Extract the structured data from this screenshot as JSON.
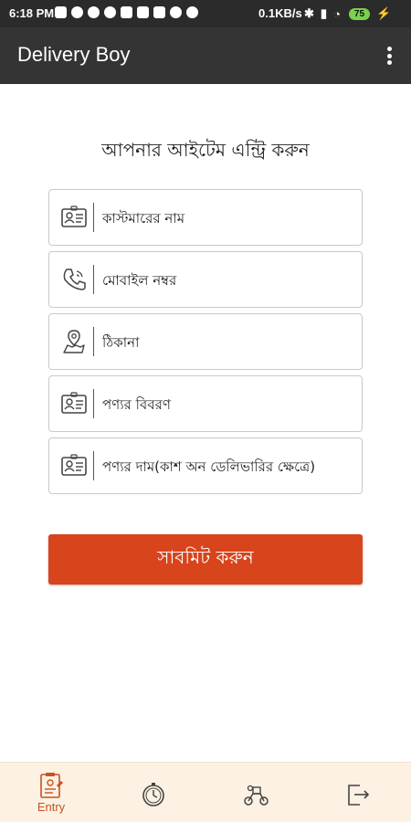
{
  "status_bar": {
    "time": "6:18 PM",
    "network_speed": "0.1KB/s",
    "battery": "75"
  },
  "app_bar": {
    "title": "Delivery Boy",
    "menu_icon": "more-vert-icon"
  },
  "form": {
    "heading": "আপনার আইটেম এন্ট্রি করুন",
    "fields": [
      {
        "icon": "id-card-icon",
        "label": "কাস্টমারের নাম"
      },
      {
        "icon": "phone-icon",
        "label": "মোবাইল নম্বর"
      },
      {
        "icon": "map-pin-icon",
        "label": "ঠিকানা"
      },
      {
        "icon": "id-card-icon",
        "label": "পণ্যর বিবরণ"
      },
      {
        "icon": "id-card-icon",
        "label": "পণ্যর দাম(কাশ অন ডেলিভারির ক্ষেত্রে)"
      }
    ],
    "submit_label": "সাবমিট করুন"
  },
  "bottom_nav": {
    "active_color": "#c8531f",
    "items": [
      {
        "icon": "entry-form-icon",
        "label": "Entry"
      },
      {
        "icon": "timer-icon",
        "label": ""
      },
      {
        "icon": "delivery-scooter-icon",
        "label": ""
      },
      {
        "icon": "logout-icon",
        "label": ""
      }
    ]
  }
}
